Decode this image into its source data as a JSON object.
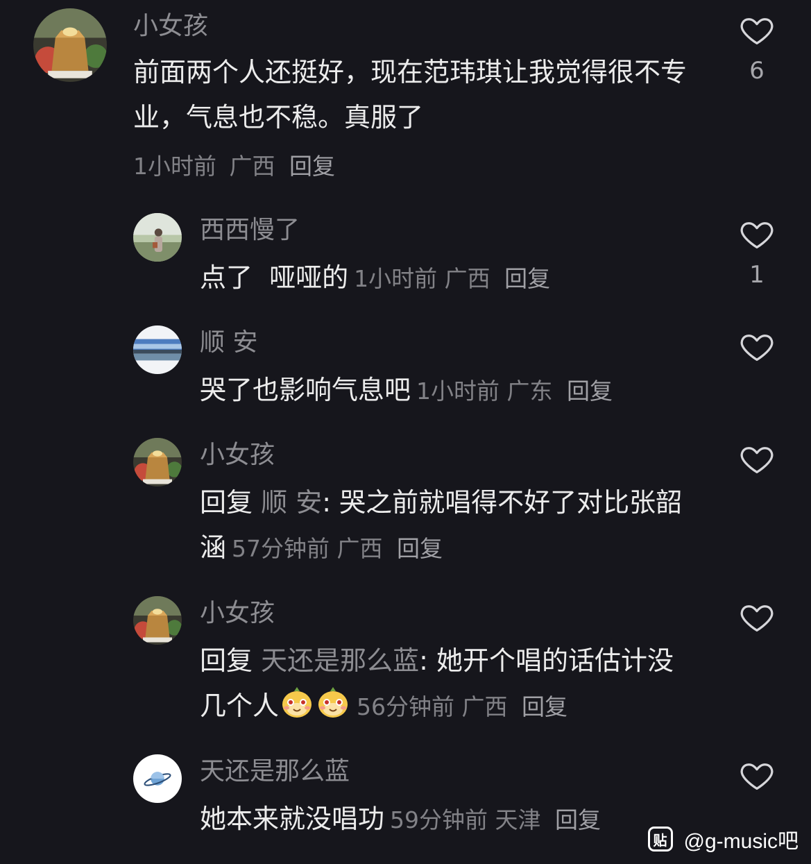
{
  "comments": [
    {
      "username": "小女孩",
      "text": "前面两个人还挺好，现在范玮琪让我觉得很不专业，气息也不稳。真服了",
      "time": "1小时前",
      "location": "广西",
      "reply_label": "回复",
      "likes": "6",
      "avatar_icon": "cake-box-avatar"
    },
    {
      "username": "西西慢了",
      "text": "点了  哑哑的",
      "time": "1小时前",
      "location": "广西",
      "reply_label": "回复",
      "likes": "1",
      "avatar_icon": "person-photo-avatar"
    },
    {
      "username": "顺 安",
      "text": "哭了也影响气息吧",
      "time": "1小时前",
      "location": "广东",
      "reply_label": "回复",
      "likes": "",
      "avatar_icon": "sky-lake-avatar"
    },
    {
      "username": "小女孩",
      "reply_prefix": "回复",
      "reply_to": "顺 安",
      "text": "哭之前就唱得不好了对比张韶涵",
      "time": "57分钟前",
      "location": "广西",
      "reply_label": "回复",
      "likes": "",
      "avatar_icon": "cake-box-avatar"
    },
    {
      "username": "小女孩",
      "reply_prefix": "回复",
      "reply_to": "天还是那么蓝",
      "text": "她开个唱的话估计没几个人",
      "emojis": [
        "smug-face-emoji",
        "smug-face-emoji"
      ],
      "time": "56分钟前",
      "location": "广西",
      "reply_label": "回复",
      "likes": "",
      "avatar_icon": "planet-avatar"
    },
    {
      "username": "天还是那么蓝",
      "text": "她本来就没唱功",
      "time": "59分钟前",
      "location": "天津",
      "reply_label": "回复",
      "likes": "",
      "avatar_icon": "planet-avatar"
    }
  ],
  "watermark": {
    "badge": "贴",
    "text": "@g-music吧"
  },
  "colors": {
    "background": "#16161c",
    "text": "#ececec",
    "muted": "#8d8d92"
  }
}
